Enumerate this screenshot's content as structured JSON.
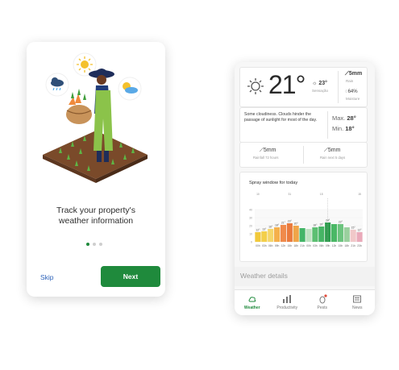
{
  "onboarding": {
    "title_line1": "Track your property's",
    "title_line2": "weather information",
    "skip_label": "Skip",
    "next_label": "Next",
    "page_count": 3,
    "active_page": 1
  },
  "weather": {
    "temperature": "21°",
    "feels_like": "23°",
    "feels_like_label": "Sensação",
    "rain_value": "5mm",
    "rain_label": "Rain",
    "moisture_value": "64%",
    "moisture_label": "Moisture",
    "description": "Some cloudiness. Clouds hinder the passage of sunlight for most of the day.",
    "max_label": "Max.",
    "max_value": "28°",
    "min_label": "Min.",
    "min_value": "18°",
    "rain_last_value": "5mm",
    "rain_last_label": "Rainfall 72 hours",
    "rain_next_value": "5mm",
    "rain_next_label": "Rain next 5 days",
    "spray_title": "Spray window for today",
    "details_label": "Weather details",
    "tabs": [
      {
        "label": "Weather",
        "icon": "weather-icon",
        "active": true
      },
      {
        "label": "Productivity",
        "icon": "productivity-icon",
        "active": false
      },
      {
        "label": "Pests",
        "icon": "pests-icon",
        "active": false
      },
      {
        "label": "News",
        "icon": "news-icon",
        "active": false
      }
    ]
  },
  "chart_data": {
    "type": "bar",
    "title": "",
    "x": [
      "00h",
      "03h",
      "06h",
      "09h",
      "12h",
      "15h",
      "18h",
      "21h",
      "00h",
      "03h",
      "06h",
      "09h",
      "12h",
      "15h",
      "18h",
      "21h",
      "23h"
    ],
    "wind_labels": [
      "10",
      "",
      "",
      "",
      "",
      "31",
      "",
      "",
      "",
      "",
      "15",
      "",
      "",
      "",
      "",
      "",
      "15"
    ],
    "temp_labels": [
      "12°",
      "13°",
      "16°",
      "18°",
      "21°",
      "23°",
      "20°",
      "",
      "",
      "18°",
      "19°",
      "24°",
      "",
      "22°",
      "",
      "15°",
      "12°"
    ],
    "colors": [
      "#f1c93b",
      "#f3cf4a",
      "#f5d66a",
      "#f5b04b",
      "#f08a4b",
      "#ea7a3d",
      "#f0a548",
      "#43b567",
      "#bfe2c2",
      "#5cbf72",
      "#46b565",
      "#2f9d4f",
      "#4ab866",
      "#6cc47e",
      "#9ad09e",
      "#f1c8c9",
      "#eaaaba"
    ],
    "temps": [
      12,
      13,
      16,
      18,
      21,
      23,
      20,
      17,
      16,
      18,
      19,
      24,
      22,
      22,
      18,
      15,
      12
    ],
    "y_ticks": [
      "40",
      "30",
      "20",
      "10",
      "0"
    ],
    "xlabel": "",
    "ylabel": ""
  }
}
